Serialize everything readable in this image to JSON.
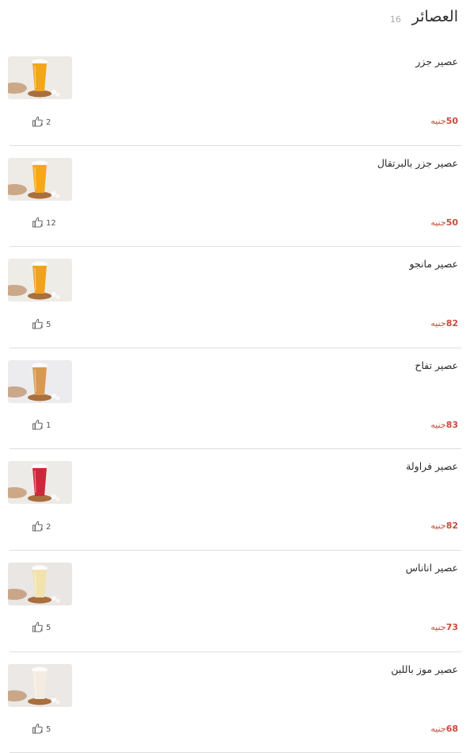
{
  "header": {
    "title": "العصائر",
    "count": "16"
  },
  "currency": "جنيه",
  "items": [
    {
      "name": "عصير جزر",
      "price": "50",
      "likes": "2",
      "image": "carrot-juice",
      "juice_color": "#f3a51b",
      "bg_color": "#eeeae6"
    },
    {
      "name": "عصير جزر بالبرتقال",
      "price": "50",
      "likes": "12",
      "image": "carrot-orange-juice",
      "juice_color": "#f6a816",
      "bg_color": "#eeeae6"
    },
    {
      "name": "عصير مانجو",
      "price": "82",
      "likes": "5",
      "image": "mango-juice",
      "juice_color": "#f0a21e",
      "bg_color": "#eeece7"
    },
    {
      "name": "عصير تفاح",
      "price": "83",
      "likes": "1",
      "image": "apple-juice",
      "juice_color": "#d89a50",
      "bg_color": "#ececef"
    },
    {
      "name": "عصير فراولة",
      "price": "82",
      "likes": "2",
      "image": "strawberry-juice",
      "juice_color": "#d0263b",
      "bg_color": "#edebe8"
    },
    {
      "name": "عصير اناناس",
      "price": "73",
      "likes": "5",
      "image": "pineapple-juice",
      "juice_color": "#f1e2ae",
      "bg_color": "#e9e6e3"
    },
    {
      "name": "عصير موز باللبن",
      "price": "68",
      "likes": "5",
      "image": "banana-milk-juice",
      "juice_color": "#f5ece1",
      "bg_color": "#ebe8e5"
    }
  ]
}
